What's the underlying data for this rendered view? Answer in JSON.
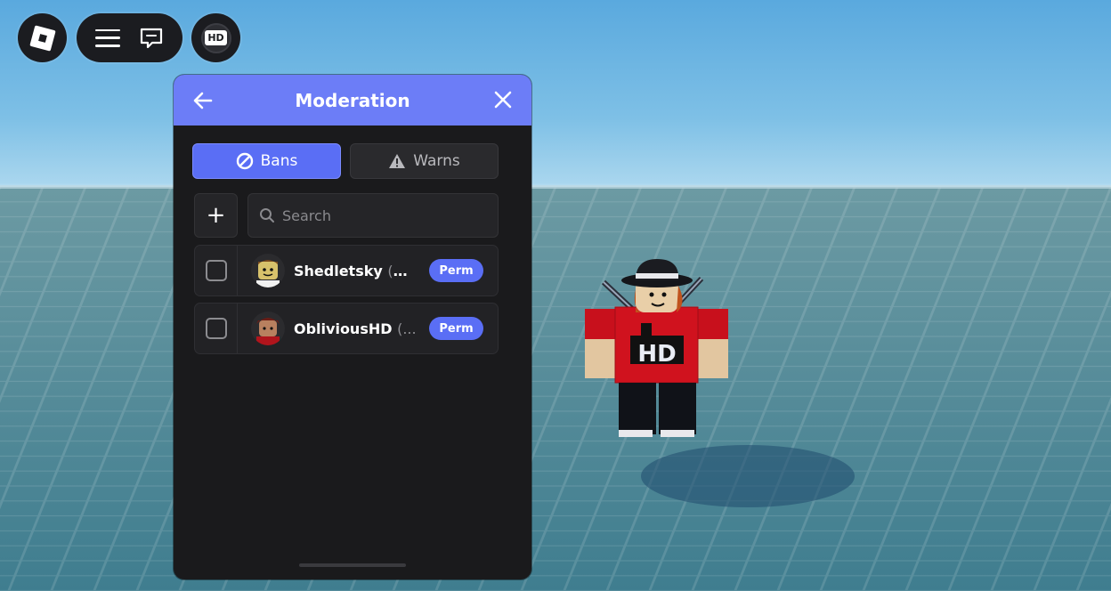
{
  "topbar": {
    "roblox_icon": "roblox-logo-icon",
    "menu_icon": "hamburger-menu-icon",
    "chat_icon": "chat-bubble-icon",
    "hd_label": "HD"
  },
  "panel": {
    "title": "Moderation",
    "back_icon": "arrow-left-icon",
    "close_icon": "close-icon",
    "accent_color": "#6c7df7"
  },
  "tabs": [
    {
      "label": "Bans",
      "icon": "ban-icon",
      "active": true
    },
    {
      "label": "Warns",
      "icon": "warning-triangle-icon",
      "active": false
    }
  ],
  "add_label": "+",
  "search": {
    "placeholder": "Search",
    "value": ""
  },
  "bans": [
    {
      "name": "Shedletsky",
      "handle": "(@S...",
      "badge": "Perm",
      "checked": false
    },
    {
      "name": "ObliviousHD",
      "handle": "(...",
      "badge": "Perm",
      "checked": false
    }
  ]
}
